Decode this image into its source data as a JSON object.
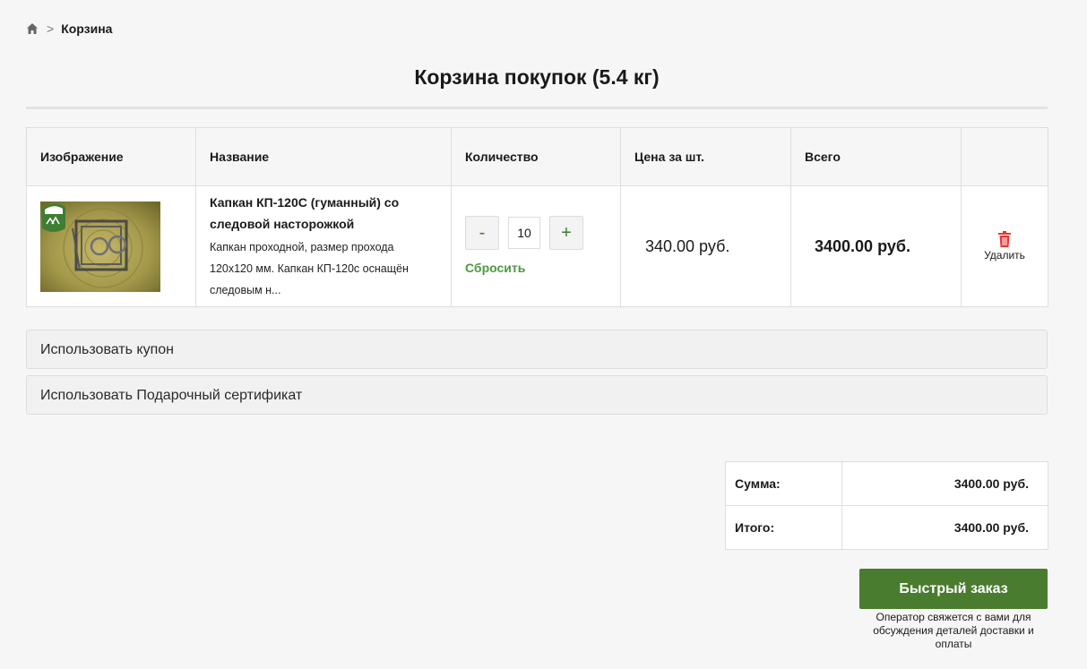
{
  "breadcrumb": {
    "home_icon": "home-icon",
    "separator": ">",
    "current": "Корзина"
  },
  "page": {
    "title": "Корзина покупок  (5.4 кг)"
  },
  "cart_table": {
    "headers": [
      "Изображение",
      "Название",
      "Количество",
      "Цена за шт.",
      "Всего",
      ""
    ],
    "rows": [
      {
        "image_alt": "Капкан КП-120С (гуманный) со следовой насторожкой",
        "name": "Капкан КП-120С (гуманный) со следовой насторожкой",
        "description": "Капкан проходной, размер прохода 120x120 мм. Капкан КП-120с оснащён следовым н...",
        "qty_minus": "-",
        "qty_value": "10",
        "qty_plus": "+",
        "reset_label": "Сбросить",
        "unit_price": "340.00 руб.",
        "total": "3400.00 руб.",
        "delete_icon": "trash-icon",
        "delete_label": "Удалить"
      }
    ]
  },
  "coupon": {
    "label": "Использовать купон"
  },
  "gift_certificate": {
    "label": "Использовать Подарочный сертификат"
  },
  "totals": {
    "subtotal_label": "Сумма:",
    "subtotal_value": "3400.00 руб.",
    "total_label": "Итого:",
    "total_value": "3400.00 руб."
  },
  "quick_order": {
    "button_label": "Быстрый заказ",
    "note": "Оператор свяжется с вами для обсуждения деталей доставки и оплаты"
  },
  "colors": {
    "accent_green": "#4a7c2f",
    "link_green": "#4c9a3f",
    "delete_red": "#e53935"
  }
}
